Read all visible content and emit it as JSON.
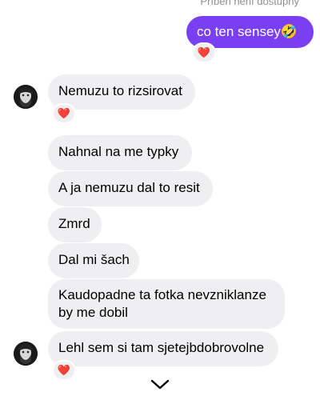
{
  "status": {
    "top_text": "Příběh není dostupný"
  },
  "messages": {
    "out1": {
      "text": "co ten sensey🤣"
    },
    "m1": {
      "text": "Nemuzu to rizsirovat"
    },
    "m2": {
      "text": "Nahnal na me typky"
    },
    "m3": {
      "text": "A ja nemuzu dal to resit"
    },
    "m4": {
      "text": "Zmrd"
    },
    "m5": {
      "text": "Dal mi šach"
    },
    "m6": {
      "line1": "Kaudopadne ta fotka nevzniklanze",
      "line2": "by me dobil"
    },
    "m7": {
      "text": "Lehl sem si tam sjetejbdobrovolne"
    }
  },
  "reactions": {
    "heart": "❤️"
  },
  "colors": {
    "outgoing": "#7b3ff2",
    "incoming": "#efeff1",
    "heart": "#e0245e"
  },
  "icons": {
    "scroll_down": "chevron-down-icon",
    "avatar": "contact-avatar"
  }
}
